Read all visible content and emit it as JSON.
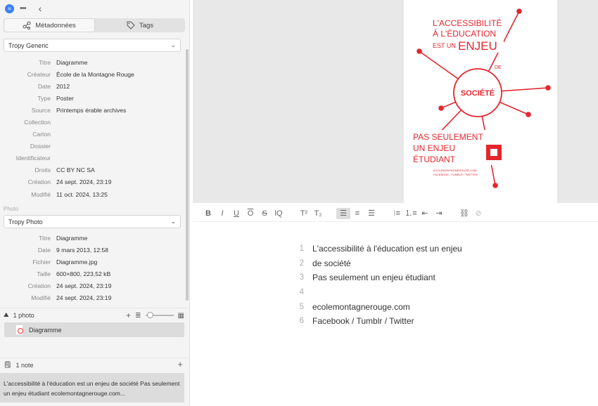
{
  "sidebar": {
    "tabs": [
      {
        "label": "Métadonnées",
        "icon": "tag-network-icon"
      },
      {
        "label": "Tags",
        "icon": "tag-icon"
      }
    ],
    "item_template": "Tropy Generic",
    "item_fields": [
      {
        "label": "Titre",
        "value": "Diagramme"
      },
      {
        "label": "Créateur",
        "value": "École de la Montagne Rouge"
      },
      {
        "label": "Date",
        "value": "2012"
      },
      {
        "label": "Type",
        "value": "Poster"
      },
      {
        "label": "Source",
        "value": "Printemps érable archives"
      },
      {
        "label": "Collection",
        "value": ""
      },
      {
        "label": "Carton",
        "value": ""
      },
      {
        "label": "Dossier",
        "value": ""
      },
      {
        "label": "Identificateur",
        "value": ""
      },
      {
        "label": "Droits",
        "value": "CC BY NC SA"
      },
      {
        "label": "Création",
        "value": "24 sept. 2024, 23:19"
      },
      {
        "label": "Modifié",
        "value": "11 oct. 2024, 13:25"
      }
    ],
    "photo_section_label": "Photo",
    "photo_template": "Tropy Photo",
    "photo_fields": [
      {
        "label": "Titre",
        "value": "Diagramme"
      },
      {
        "label": "Date",
        "value": "9 mars 2013, 12:58"
      },
      {
        "label": "Fichier",
        "value": "Diagramme.jpg"
      },
      {
        "label": "Taille",
        "value": "600×800, 223,52 kB"
      },
      {
        "label": "Création",
        "value": "24 sept. 2024, 23:19"
      },
      {
        "label": "Modifié",
        "value": "24 sept. 2024, 23:19"
      }
    ],
    "photos_header": "1 photo",
    "photo_item": "Diagramme",
    "notes_header": "1 note",
    "note_preview": "L'accessibilité à l'éducation est un enjeu de société Pas seulement un enjeu étudiant ecolemontagnerouge.com..."
  },
  "poster": {
    "line1": "L'ACCESSIBILITÉ",
    "line2": "À L'ÉDUCATION",
    "line3_small": "EST UN",
    "line3_big": "ENJEU",
    "de": "DE",
    "center": "SOCIÉTÉ",
    "bottom1": "PAS SEULEMENT",
    "bottom2": "UN ENJEU",
    "bottom3": "ÉTUDIANT",
    "footer1": "ECOLEMONTAGNEROUGE.COM",
    "footer2": "FACEBOOK / TUMBLR / TWITTER",
    "accent": "#e3262e"
  },
  "toolbar": {
    "buttons": [
      "B",
      "I",
      "U",
      "O",
      "S",
      "lQ",
      "T²",
      "T₂"
    ]
  },
  "note": {
    "lines": [
      {
        "n": "1",
        "text": "L'accessibilité à l'éducation est un enjeu"
      },
      {
        "n": "2",
        "text": "de société"
      },
      {
        "n": "3",
        "text": "Pas seulement un enjeu étudiant"
      },
      {
        "n": "4",
        "text": ""
      },
      {
        "n": "5",
        "text": "ecolemontagnerouge.com"
      },
      {
        "n": "6",
        "text": "Facebook / Tumblr / Twitter"
      }
    ]
  }
}
